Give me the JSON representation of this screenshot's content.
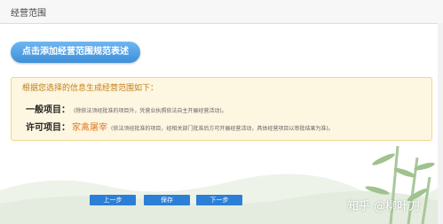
{
  "section": {
    "title": "经营范围"
  },
  "add_button": {
    "label": "点击添加经营范围规范表述"
  },
  "panel": {
    "header": "根据您选择的信息生成经营范围如下：",
    "general": {
      "label": "一般项目：",
      "note": "(除依法须经批准的项目外，凭营业执照依法自主开展经营活动)。"
    },
    "licensed": {
      "label": "许可项目：",
      "item": "家禽屠宰",
      "note": "(依法须经批准的项目，经相关部门批准后方可开展经营活动，具体经营项目以审批结果为准)。"
    }
  },
  "nav": {
    "prev": "上一步",
    "save": "保存",
    "next": "下一步"
  },
  "watermark": "知乎 @柳叶刀",
  "colors": {
    "accent": "#2b7fd6",
    "panel_bg": "#fdf6e0",
    "highlight": "#e07b2a"
  }
}
